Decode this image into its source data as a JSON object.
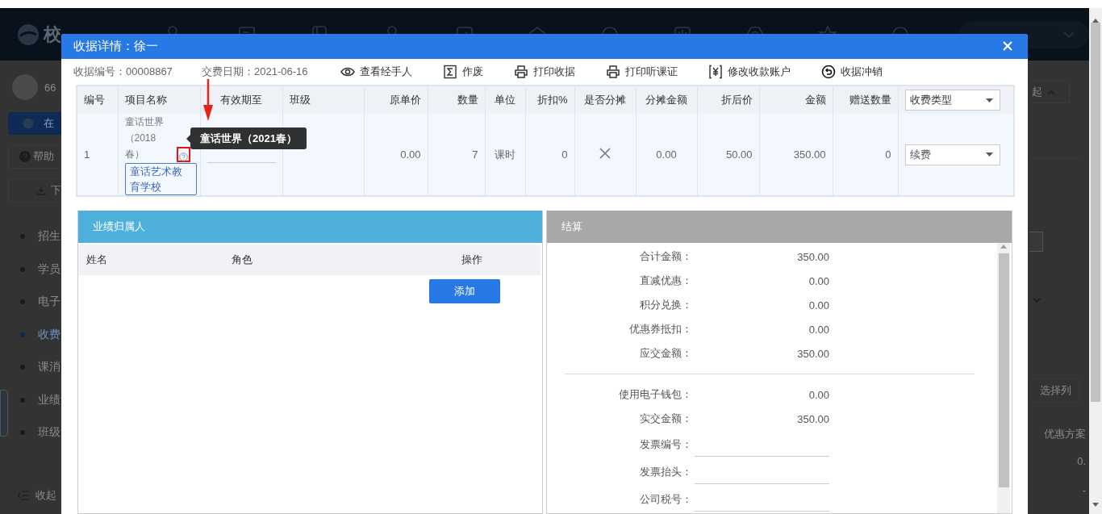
{
  "app": {
    "logo": "校",
    "user": "66",
    "online_button": "在",
    "help": "帮助",
    "download": "下",
    "menu": [
      {
        "label": "招生",
        "selected": false
      },
      {
        "label": "学员",
        "selected": false
      },
      {
        "label": "电子",
        "selected": false
      },
      {
        "label": "收费",
        "selected": true
      },
      {
        "label": "课消",
        "selected": false
      },
      {
        "label": "业绩",
        "selected": false
      },
      {
        "label": "班级",
        "selected": false
      }
    ],
    "collapse": "收起",
    "right": {
      "collapse_button": "起",
      "columns_button": "选择列",
      "column_header": "优惠方案",
      "cells": [
        "0.",
        "-"
      ]
    }
  },
  "dialog": {
    "title": "收据详情：徐一",
    "receipt_no": "收据编号：00008867",
    "date": "交费日期：2021-06-16",
    "actions": [
      "查看经手人",
      "作废",
      "打印收据",
      "打印听课证",
      "修改收款账户",
      "收据冲销"
    ],
    "table": {
      "columns": [
        {
          "label": "编号",
          "kind": "text"
        },
        {
          "label": "项目名称",
          "kind": "text"
        },
        {
          "label": "有效期至",
          "kind": "text"
        },
        {
          "label": "班级",
          "kind": "text"
        },
        {
          "label": "原单价",
          "kind": "text"
        },
        {
          "label": "数量",
          "kind": "text"
        },
        {
          "label": "单位",
          "kind": "text"
        },
        {
          "label": "折扣%",
          "kind": "text"
        },
        {
          "label": "是否分摊",
          "kind": "text"
        },
        {
          "label": "分摊金额",
          "kind": "text"
        },
        {
          "label": "折后价",
          "kind": "text"
        },
        {
          "label": "金额",
          "kind": "text"
        },
        {
          "label": "赠送数量",
          "kind": "text"
        },
        {
          "label": "收费类型",
          "kind": "select"
        }
      ],
      "rows": [
        {
          "number": "1",
          "project_name": "童话世界（2018春）",
          "school_tag": "童话艺术教育学校",
          "unit_price": "0.00",
          "quantity": "7",
          "unit": "课时",
          "discount": "0",
          "split": false,
          "split_amount": "0.00",
          "discounted_price": "50.00",
          "amount": "350.00",
          "gift_quantity": "0",
          "fee_type": "续费"
        }
      ]
    },
    "tooltip": "童话世界（2021春）",
    "performance": {
      "title": "业绩归属人",
      "columns": [
        "姓名",
        "角色",
        "操作"
      ],
      "add_button": "添加"
    },
    "settlement": {
      "title": "结算",
      "rows": [
        {
          "kind": "value",
          "label": "合计金额：",
          "value": "350.00"
        },
        {
          "kind": "value",
          "label": "直减优惠：",
          "value": "0.00"
        },
        {
          "kind": "value",
          "label": "积分兑换：",
          "value": "0.00"
        },
        {
          "kind": "value",
          "label": "优惠券抵扣：",
          "value": "0.00"
        },
        {
          "kind": "value",
          "label": "应交金额：",
          "value": "350.00"
        },
        {
          "kind": "divider"
        },
        {
          "kind": "value",
          "label": "使用电子钱包：",
          "value": "0.00"
        },
        {
          "kind": "value",
          "label": "实交金额：",
          "value": "350.00"
        },
        {
          "kind": "field",
          "label": "发票编号："
        },
        {
          "kind": "field",
          "label": "发票抬头："
        },
        {
          "kind": "field",
          "label": "公司税号："
        }
      ]
    }
  }
}
